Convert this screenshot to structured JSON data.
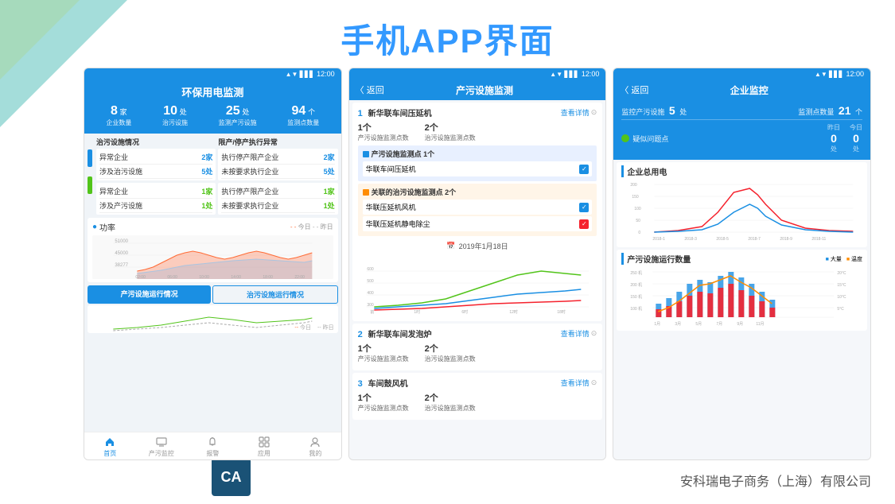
{
  "page": {
    "title": "手机APP界面",
    "company": "安科瑞电子商务（上海）有限公司",
    "ca_badge": "CA"
  },
  "screen1": {
    "header": {
      "title": "环保用电监测",
      "time": "12:00"
    },
    "stats": [
      {
        "num": "8",
        "unit": "家",
        "label": "企业数量"
      },
      {
        "num": "10",
        "unit": "处",
        "label": "治污设施"
      },
      {
        "num": "25",
        "unit": "处",
        "label": "监测产污设施"
      },
      {
        "num": "94",
        "unit": "个",
        "label": "监测点数量"
      }
    ],
    "section1_title": "治污设施情况",
    "section2_title": "限产/停产执行异常",
    "rows1": [
      {
        "label": "异常企业",
        "val": "2家"
      },
      {
        "label": "涉及治污设施",
        "val": "5处"
      }
    ],
    "rows2": [
      {
        "label": "执行停产限产企业",
        "val": "2家"
      },
      {
        "label": "未按要求执行企业",
        "val": "5处"
      }
    ],
    "rows3": [
      {
        "label": "异常企业",
        "val": "1家"
      },
      {
        "label": "涉及产污设施",
        "val": "1处"
      }
    ],
    "rows4": [
      {
        "label": "执行停产限产企业",
        "val": "1家"
      },
      {
        "label": "未按要求执行企业",
        "val": "1处"
      }
    ],
    "chart_title": "功率",
    "chart_legend": [
      "今日",
      "昨日"
    ],
    "tabs": [
      "产污设施运行情况",
      "治污设施运行情况"
    ],
    "bottom_nav": [
      "首页",
      "产污监控",
      "报警",
      "应用",
      "我的"
    ]
  },
  "screen2": {
    "header": {
      "back": "〈 返回",
      "title": "产污设施监测",
      "time": "12:00"
    },
    "items": [
      {
        "num": "1",
        "name": "新华联车间压延机",
        "detail_link": "查看详情",
        "stat1_label": "1个\n产污设施监测点数",
        "stat2_label": "2个\n治污设施监测点数",
        "monitor1_title": "产污设施监测点 1个",
        "monitor1_items": [
          "华联车间压延机"
        ],
        "monitor2_title": "关联的治污设施监测点 2个",
        "monitor2_items": [
          "华联压延机风机",
          "华联压延机静电除尘"
        ],
        "date": "2019年1月18日"
      },
      {
        "num": "2",
        "name": "新华联车间发泡炉",
        "detail_link": "查看详情",
        "stat1_label": "1个\n产污设施监测点数",
        "stat2_label": "2个\n治污设施监测点数"
      },
      {
        "num": "3",
        "name": "车间鼓风机",
        "detail_link": "查看详情",
        "stat1_label": "1个\n产污设施监测点数",
        "stat2_label": "2个\n治污设施监测点数"
      }
    ]
  },
  "screen3": {
    "header": {
      "back": "〈 返回",
      "title": "企业监控",
      "time": "12:00"
    },
    "top_stats": [
      {
        "label": "监控产污设施",
        "val": "5",
        "unit": "处"
      },
      {
        "label": "监测点数量",
        "val": "21",
        "unit": "个"
      }
    ],
    "problem_label": "疑似问题点",
    "yesterday_label": "昨日",
    "today_label": "今日",
    "yesterday_val": "0",
    "today_val": "0",
    "yesterday_unit": "处",
    "today_unit": "处",
    "chart1_title": "企业总用电",
    "chart2_title": "产污设施运行数量",
    "chart2_legend": [
      "大量",
      "温度"
    ],
    "colors": {
      "primary": "#1a8fe3",
      "accent": "#ff6b35",
      "green": "#52c41a",
      "red": "#f5222d"
    }
  }
}
